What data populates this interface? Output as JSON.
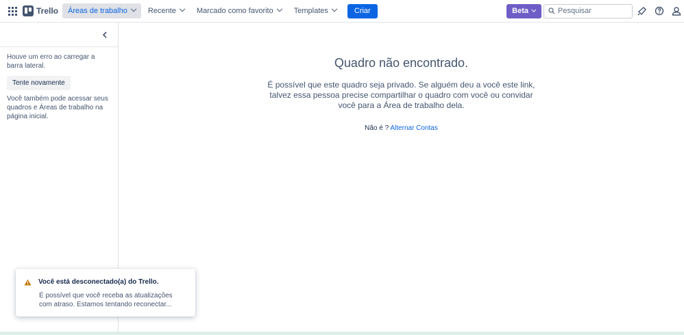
{
  "header": {
    "logo_text": "Trello",
    "nav": [
      {
        "label": "Áreas de trabalho"
      },
      {
        "label": "Recente"
      },
      {
        "label": "Marcado como favorito"
      },
      {
        "label": "Templates"
      }
    ],
    "create_label": "Criar",
    "beta_label": "Beta",
    "search_placeholder": "Pesquisar"
  },
  "sidebar": {
    "error_text": "Houve um erro ao carregar a barra lateral.",
    "retry_label": "Tente novamente",
    "hint_text": "Você também pode acessar seus quadros e Áreas de trabalho na página inicial."
  },
  "main": {
    "title": "Quadro não encontrado.",
    "description": "É possível que este quadro seja privado. Se alguém deu a você este link, talvez essa pessoa precise compartilhar o quadro com você ou convidar você para a Área de trabalho dela.",
    "not_you": "Não é ?",
    "switch_accounts": "Alternar Contas"
  },
  "toast": {
    "title": "Você está desconectado(a) do Trello.",
    "message": "É possível que você receba as atualizações com atraso. Estamos tentando reconectar..."
  },
  "colors": {
    "primary": "#0c66e4",
    "beta": "#6e5dc6",
    "warning": "#e2b203"
  }
}
